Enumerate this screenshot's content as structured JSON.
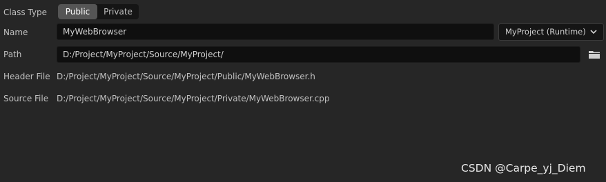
{
  "class_type": {
    "label": "Class Type",
    "options": [
      "Public",
      "Private"
    ],
    "selected": "Public"
  },
  "name": {
    "label": "Name",
    "value": "MyWebBrowser"
  },
  "module": {
    "selected": "MyProject (Runtime)",
    "icon": "chevron-down-icon"
  },
  "path": {
    "label": "Path",
    "value": "D:/Project/MyProject/Source/MyProject/",
    "browse_icon": "folder-icon"
  },
  "header_file": {
    "label": "Header File",
    "value": "D:/Project/MyProject/Source/MyProject/Public/MyWebBrowser.h"
  },
  "source_file": {
    "label": "Source File",
    "value": "D:/Project/MyProject/Source/MyProject/Private/MyWebBrowser.cpp"
  },
  "watermark": "CSDN @Carpe_yj_Diem",
  "colors": {
    "background": "#262626",
    "input_background": "#0f0f0f",
    "active_segment": "#555555",
    "text": "#c0c0c0"
  }
}
